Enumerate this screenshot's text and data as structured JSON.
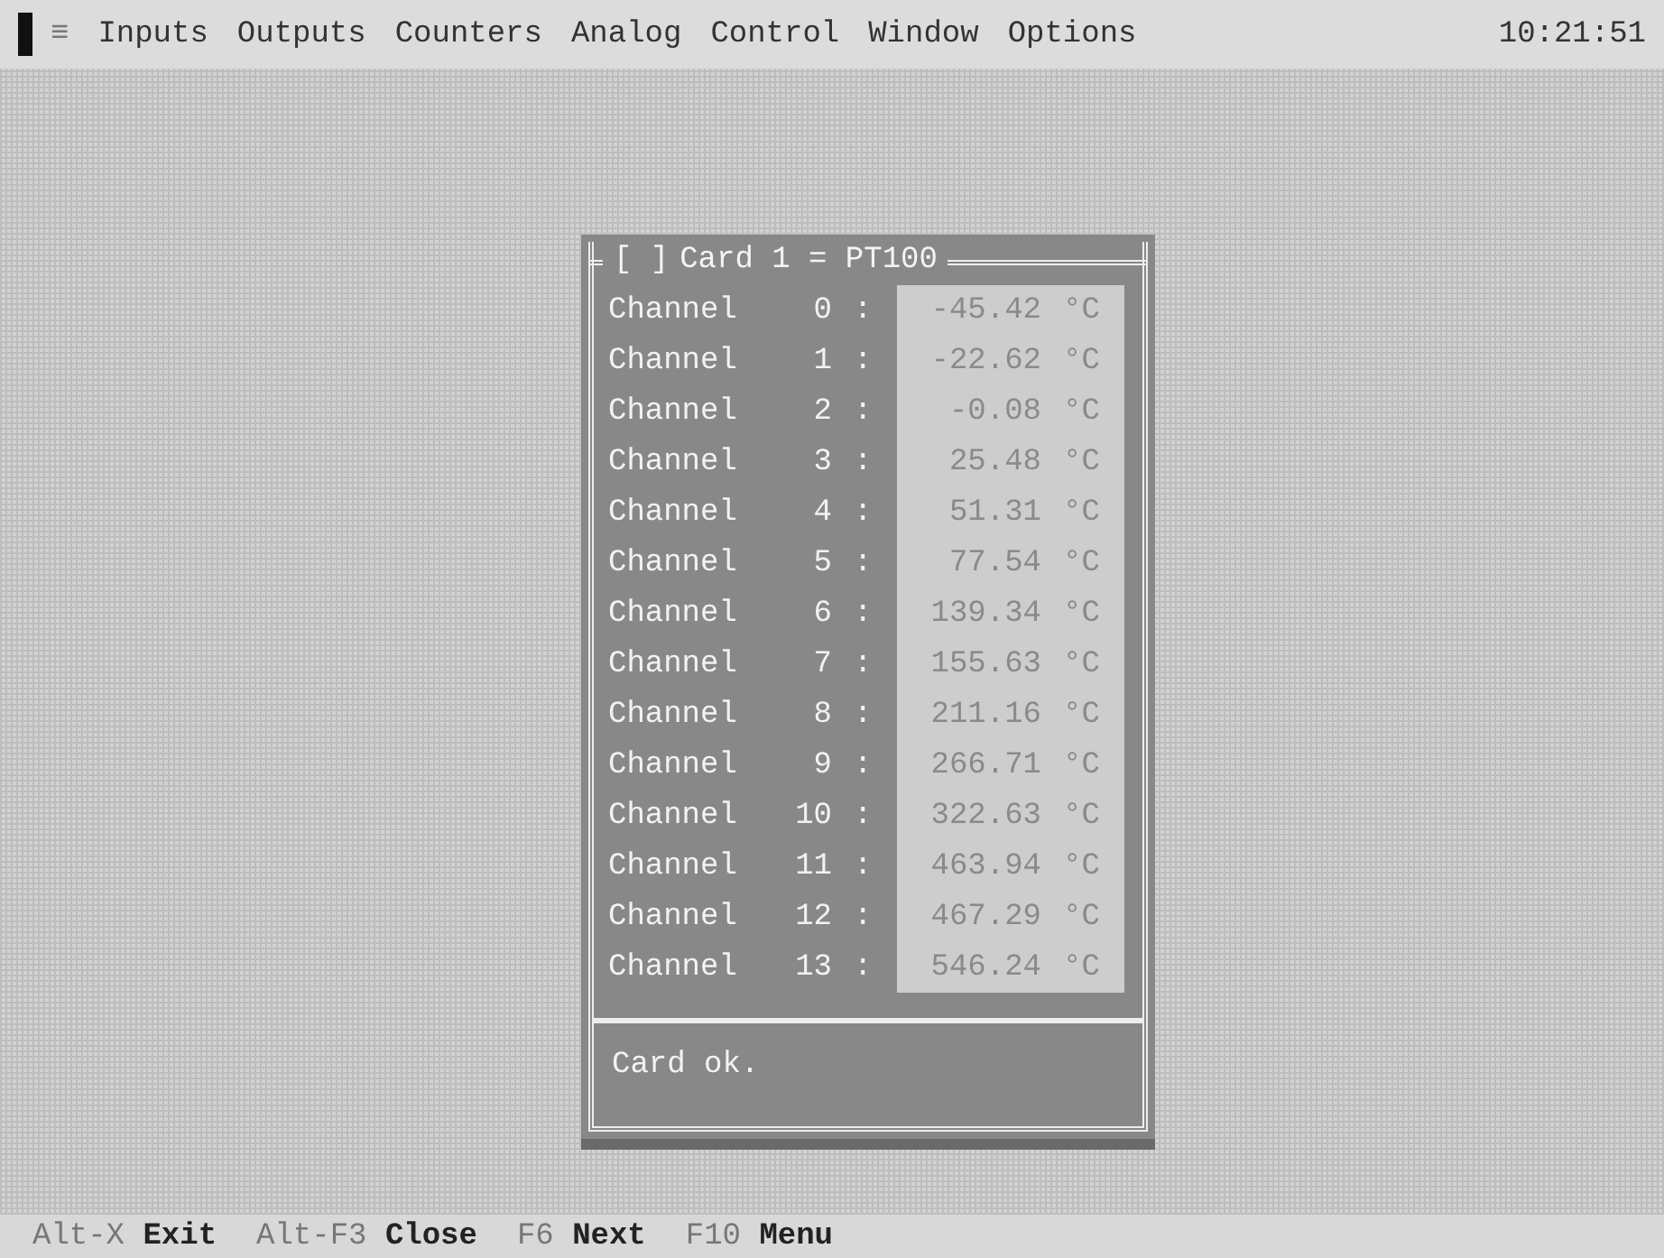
{
  "menu_bar": {
    "system_menu": "≡",
    "items": [
      "Inputs",
      "Outputs",
      "Counters",
      "Analog",
      "Control",
      "Window",
      "Options"
    ],
    "clock": "10:21:51"
  },
  "window": {
    "close_box": "[ ]",
    "title": "Card 1 = PT100",
    "channels": [
      {
        "name": "Channel",
        "number": "0",
        "separator": ":",
        "value": "-45.42",
        "unit": "°C"
      },
      {
        "name": "Channel",
        "number": "1",
        "separator": ":",
        "value": "-22.62",
        "unit": "°C"
      },
      {
        "name": "Channel",
        "number": "2",
        "separator": ":",
        "value": "-0.08",
        "unit": "°C"
      },
      {
        "name": "Channel",
        "number": "3",
        "separator": ":",
        "value": "25.48",
        "unit": "°C"
      },
      {
        "name": "Channel",
        "number": "4",
        "separator": ":",
        "value": "51.31",
        "unit": "°C"
      },
      {
        "name": "Channel",
        "number": "5",
        "separator": ":",
        "value": "77.54",
        "unit": "°C"
      },
      {
        "name": "Channel",
        "number": "6",
        "separator": ":",
        "value": "139.34",
        "unit": "°C"
      },
      {
        "name": "Channel",
        "number": "7",
        "separator": ":",
        "value": "155.63",
        "unit": "°C"
      },
      {
        "name": "Channel",
        "number": "8",
        "separator": ":",
        "value": "211.16",
        "unit": "°C"
      },
      {
        "name": "Channel",
        "number": "9",
        "separator": ":",
        "value": "266.71",
        "unit": "°C"
      },
      {
        "name": "Channel",
        "number": "10",
        "separator": ":",
        "value": "322.63",
        "unit": "°C"
      },
      {
        "name": "Channel",
        "number": "11",
        "separator": ":",
        "value": "463.94",
        "unit": "°C"
      },
      {
        "name": "Channel",
        "number": "12",
        "separator": ":",
        "value": "467.29",
        "unit": "°C"
      },
      {
        "name": "Channel",
        "number": "13",
        "separator": ":",
        "value": "546.24",
        "unit": "°C"
      }
    ],
    "status": "Card ok."
  },
  "status_bar": [
    {
      "key": "Alt-X",
      "action": "Exit"
    },
    {
      "key": "Alt-F3",
      "action": "Close"
    },
    {
      "key": "F6",
      "action": "Next"
    },
    {
      "key": "F10",
      "action": "Menu"
    }
  ]
}
